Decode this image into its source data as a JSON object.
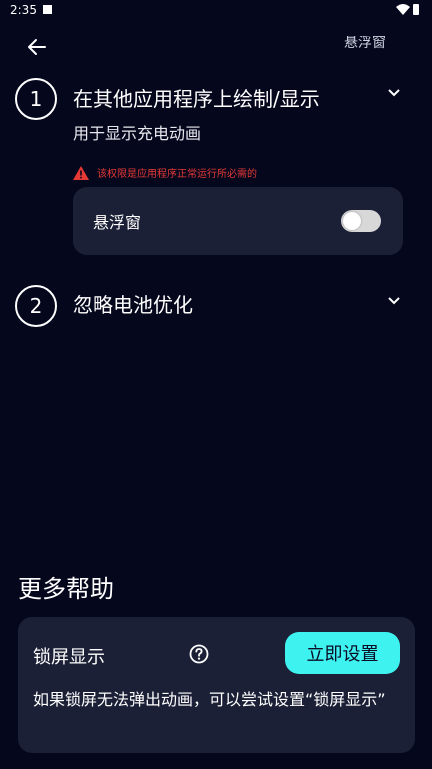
{
  "status_bar": {
    "time": "2:35"
  },
  "header": {
    "title": "悬浮窗"
  },
  "steps": [
    {
      "number": "1",
      "title": "在其他应用程序上绘制/显示",
      "subtitle": "用于显示充电动画",
      "warning": "该权限是应用程序正常运行所必需的",
      "setting": {
        "label": "悬浮窗",
        "enabled": false
      }
    },
    {
      "number": "2",
      "title": "忽略电池优化"
    }
  ],
  "help": {
    "title": "更多帮助",
    "card": {
      "label": "锁屏显示",
      "button": "立即设置",
      "description": "如果锁屏无法弹出动画，可以尝试设置“锁屏显示”"
    }
  },
  "colors": {
    "background": "#05071d",
    "card": "#1c2036",
    "accent": "#3ef2f0",
    "warning": "#e53935"
  }
}
